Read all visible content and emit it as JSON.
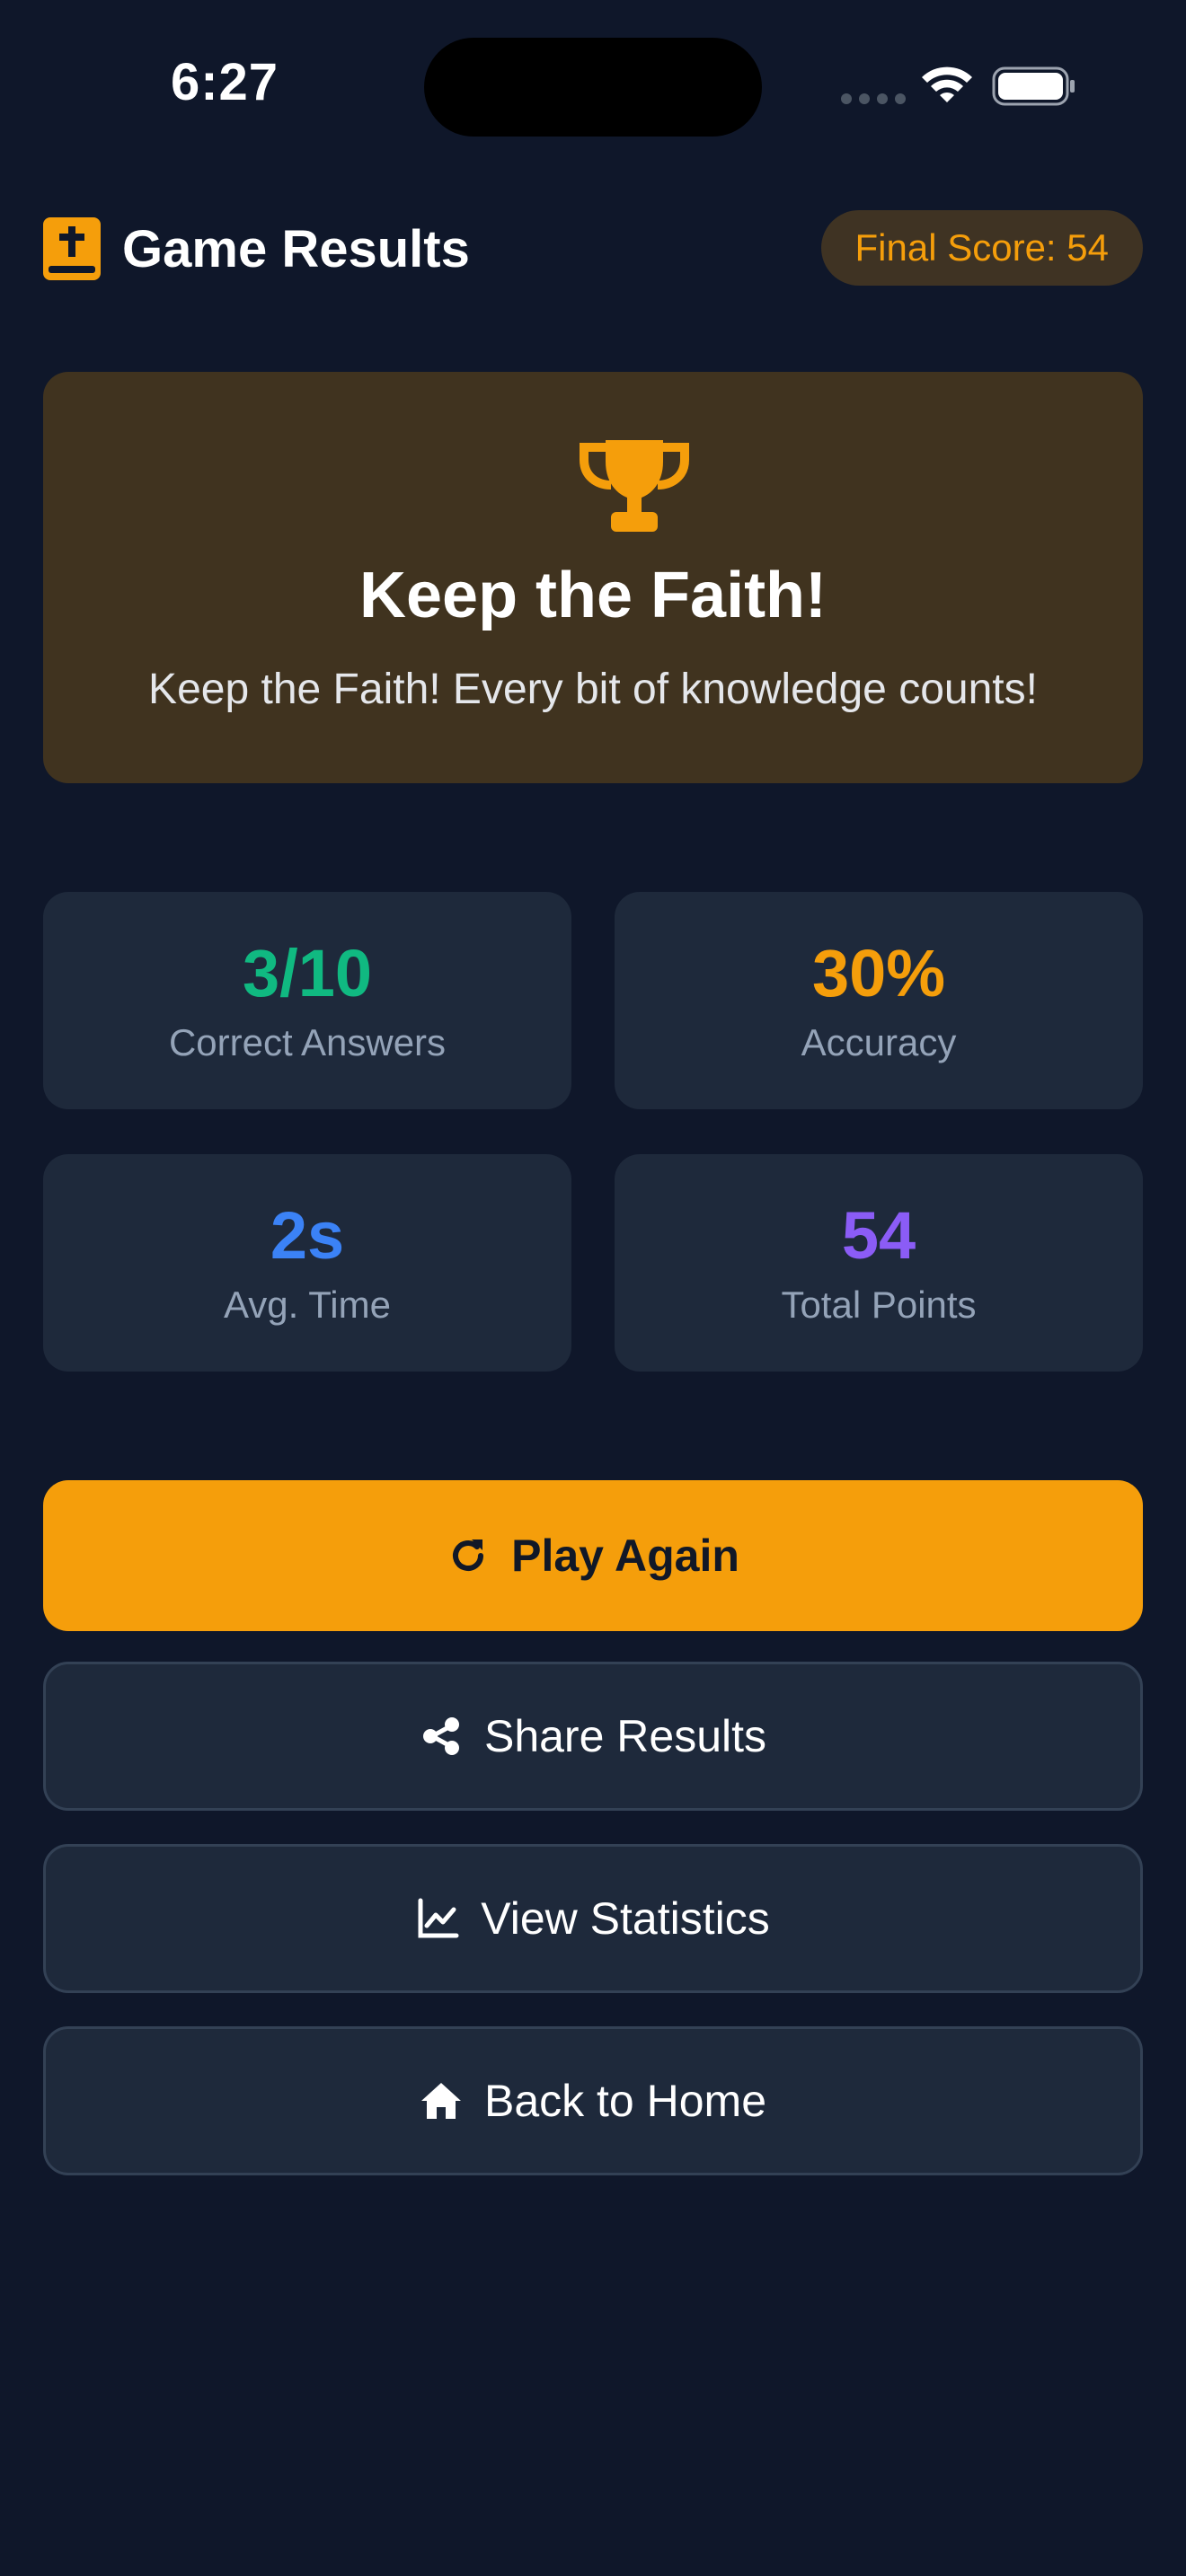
{
  "status_bar": {
    "time": "6:27"
  },
  "header": {
    "title": "Game Results",
    "score_badge": "Final Score: 54",
    "icon": "bible-icon"
  },
  "result": {
    "icon": "trophy-icon",
    "title": "Keep the Faith!",
    "message": "Keep the Faith! Every bit of knowledge counts!"
  },
  "stats": {
    "correct": {
      "value": "3/10",
      "label": "Correct Answers",
      "color": "#10b981"
    },
    "accuracy": {
      "value": "30%",
      "label": "Accuracy",
      "color": "#f59e0b"
    },
    "avg_time": {
      "value": "2s",
      "label": "Avg. Time",
      "color": "#3b82f6"
    },
    "total_points": {
      "value": "54",
      "label": "Total Points",
      "color": "#8b5cf6"
    }
  },
  "actions": {
    "play_again": {
      "label": "Play Again",
      "icon": "redo-icon"
    },
    "share": {
      "label": "Share Results",
      "icon": "share-icon"
    },
    "statistics": {
      "label": "View Statistics",
      "icon": "chart-line-icon"
    },
    "home": {
      "label": "Back to Home",
      "icon": "home-icon"
    }
  },
  "colors": {
    "background": "#0f172a",
    "accent": "#f59e0b",
    "card": "#1e293b"
  }
}
